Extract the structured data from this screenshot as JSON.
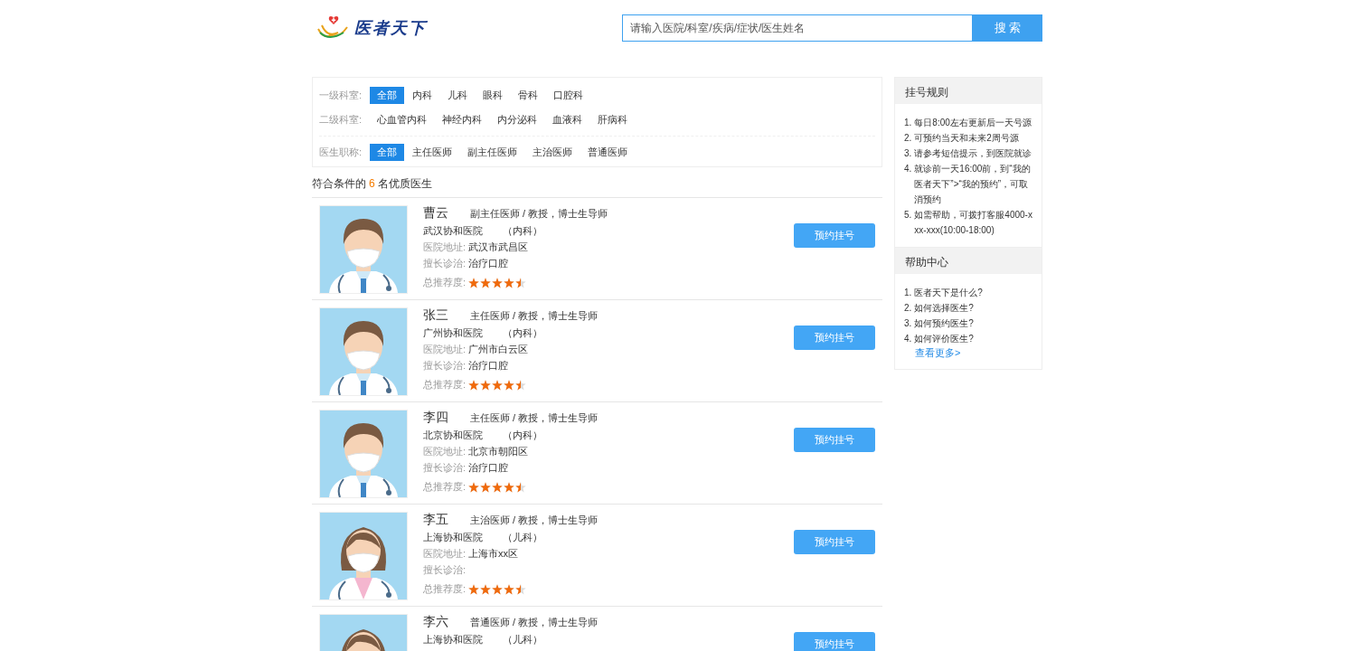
{
  "header": {
    "logo_text": "医者天下",
    "search": {
      "placeholder": "请输入医院/科室/疾病/症状/医生姓名"
    },
    "search_button": "搜 索"
  },
  "filters": [
    {
      "label": "一级科室:",
      "options": [
        {
          "text": "全部",
          "selected": true
        },
        {
          "text": "内科",
          "selected": false
        },
        {
          "text": "儿科",
          "selected": false
        },
        {
          "text": "眼科",
          "selected": false
        },
        {
          "text": "骨科",
          "selected": false
        },
        {
          "text": "口腔科",
          "selected": false
        }
      ]
    },
    {
      "label": "二级科室:",
      "options": [
        {
          "text": "心血管内科",
          "selected": false
        },
        {
          "text": "神经内科",
          "selected": false
        },
        {
          "text": "内分泌科",
          "selected": false
        },
        {
          "text": "血液科",
          "selected": false
        },
        {
          "text": "肝病科",
          "selected": false
        }
      ]
    },
    {
      "label": "医生职称:",
      "options": [
        {
          "text": "全部",
          "selected": true
        },
        {
          "text": "主任医师",
          "selected": false
        },
        {
          "text": "副主任医师",
          "selected": false
        },
        {
          "text": "主治医师",
          "selected": false
        },
        {
          "text": "普通医师",
          "selected": false
        }
      ]
    }
  ],
  "result_summary": {
    "prefix": "符合条件的",
    "count": "6",
    "suffix": "名优质医生"
  },
  "doctors": [
    {
      "kind": "male",
      "name": "曹云",
      "title": "副主任医师 / 教授，博士生导师",
      "hospital": "武汉协和医院",
      "department": "（内科）",
      "address_label": "医院地址:",
      "address": "武汉市武昌区",
      "specialty_label": "擅长诊治:",
      "specialty": "治疗口腔",
      "rating_label": "总推荐度:",
      "stars": 4.5,
      "button": "预约挂号"
    },
    {
      "kind": "male",
      "name": "张三",
      "title": "主任医师 / 教授，博士生导师",
      "hospital": "广州协和医院",
      "department": "（内科）",
      "address_label": "医院地址:",
      "address": "广州市白云区",
      "specialty_label": "擅长诊治:",
      "specialty": "治疗口腔",
      "rating_label": "总推荐度:",
      "stars": 4.5,
      "button": "预约挂号"
    },
    {
      "kind": "male",
      "name": "李四",
      "title": "主任医师 / 教授，博士生导师",
      "hospital": "北京协和医院",
      "department": "（内科）",
      "address_label": "医院地址:",
      "address": "北京市朝阳区",
      "specialty_label": "擅长诊治:",
      "specialty": "治疗口腔",
      "rating_label": "总推荐度:",
      "stars": 4.5,
      "button": "预约挂号"
    },
    {
      "kind": "female",
      "name": "李五",
      "title": "主治医师 / 教授，博士生导师",
      "hospital": "上海协和医院",
      "department": "（儿科）",
      "address_label": "医院地址:",
      "address": "上海市xx区",
      "specialty_label": "擅长诊治:",
      "rating_label": "总推荐度:",
      "stars": 4.5,
      "button": "预约挂号"
    },
    {
      "kind": "female",
      "name": "李六",
      "title": "普通医师 / 教授，博士生导师",
      "hospital": "上海协和医院",
      "department": "（儿科）",
      "button": "预约挂号"
    }
  ],
  "sidebar": [
    {
      "title": "挂号规则",
      "items": [
        {
          "number": "1.",
          "text": "每日8:00左右更新后一天号源"
        },
        {
          "number": "2.",
          "text": "可预约当天和未来2周号源"
        },
        {
          "number": "3.",
          "text": "请参考短信提示，到医院就诊"
        },
        {
          "number": "4.",
          "text": "就诊前一天16:00前，到“我的医者天下”>“我的预约”，可取消预约"
        },
        {
          "number": "5.",
          "text": "如需帮助，可拨打客服4000-xxx-xxx(10:00-18:00)"
        }
      ]
    },
    {
      "title": "帮助中心",
      "items": [
        {
          "number": "1.",
          "text": "医者天下是什么?"
        },
        {
          "number": "2.",
          "text": "如何选择医生?"
        },
        {
          "number": "3.",
          "text": "如何预约医生?"
        },
        {
          "number": "4.",
          "text": "如何评价医生?"
        }
      ],
      "link": "查看更多>"
    }
  ]
}
